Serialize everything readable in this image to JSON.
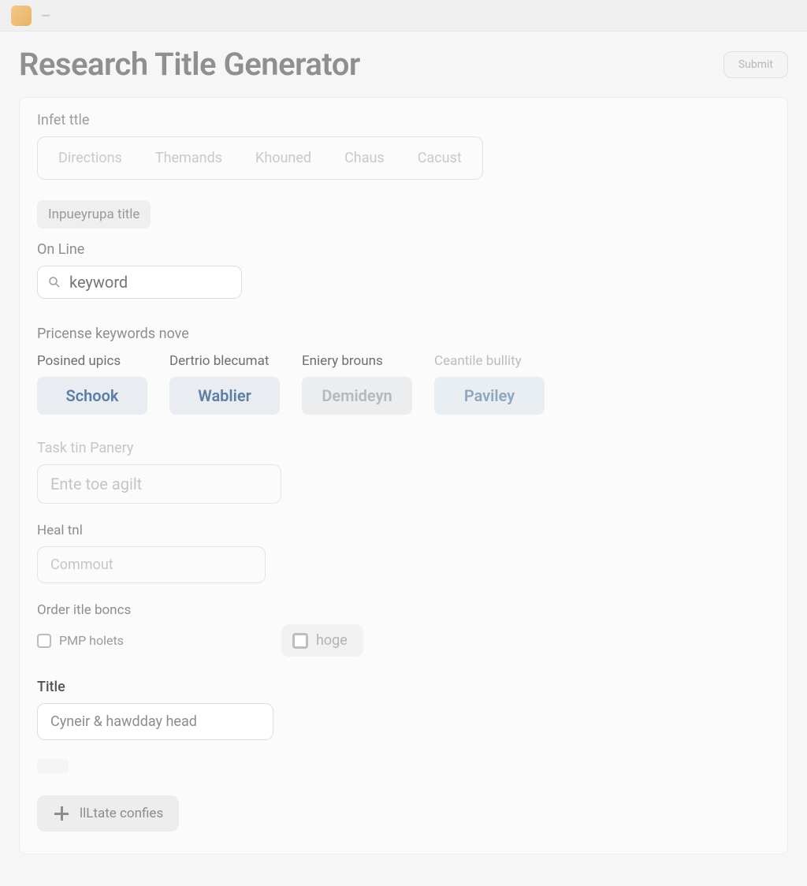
{
  "brand": {
    "name": "—"
  },
  "header": {
    "title": "Research Title Generator",
    "action_label": "Submit"
  },
  "section1": {
    "label": "Infet ttle",
    "pills": [
      "Directions",
      "Themands",
      "Khouned",
      "Chaus",
      "Cacust"
    ],
    "tag_label": "Inpueyrupa title",
    "search_label": "On Line",
    "search_placeholder": "keyword",
    "search_value": ""
  },
  "section2": {
    "label": "Pricense keywords nove",
    "cols": [
      {
        "head": "Posined upics",
        "chip": "Schook",
        "style": "default"
      },
      {
        "head": "Dertrio blecumat",
        "chip": "Wablier",
        "style": "default"
      },
      {
        "head": "Eniery brouns",
        "chip": "Demideyn",
        "style": "muted"
      },
      {
        "head": "Ceantile bullity",
        "chip": "Paviley",
        "style": "soft",
        "faint_head": true
      }
    ]
  },
  "section3": {
    "label": "Task tin Panery",
    "placeholder": "Ente toe agilt"
  },
  "section4": {
    "label": "Heal tnl",
    "placeholder": "Commout"
  },
  "section5": {
    "label": "Order itle boncs",
    "options": [
      {
        "label": "PMP holets",
        "style": "plain"
      },
      {
        "label": "hoge",
        "style": "pill"
      }
    ]
  },
  "section6": {
    "label": "Title",
    "value": "Cyneir & hawdday head"
  },
  "footer": {
    "add_label": "llLtate confies"
  }
}
